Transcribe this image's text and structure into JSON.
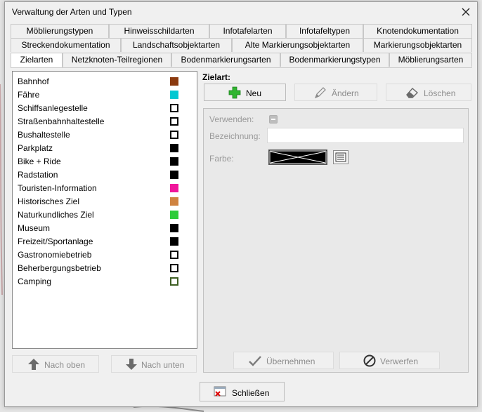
{
  "window": {
    "title": "Verwaltung der Arten und Typen"
  },
  "tabs": {
    "row1": [
      "Möblierungstypen",
      "Hinweisschildarten",
      "Infotafelarten",
      "Infotafeltypen",
      "Knotendokumentation"
    ],
    "row2": [
      "Streckendokumentation",
      "Landschaftsobjektarten",
      "Alte Markierungsobjektarten",
      "Markierungsobjektarten"
    ],
    "row3": [
      "Zielarten",
      "Netzknoten-Teilregionen",
      "Bodenmarkierungsarten",
      "Bodenmarkierungstypen",
      "Möblierungsarten"
    ],
    "selected": "Zielarten"
  },
  "zielarten": [
    {
      "label": "Bahnhof",
      "color": "#8b3a0f",
      "style": "filled"
    },
    {
      "label": "Fähre",
      "color": "#00c8d2",
      "style": "filled"
    },
    {
      "label": "Schiffsanlegestelle",
      "color": "#000000",
      "style": "outline"
    },
    {
      "label": "Straßenbahnhaltestelle",
      "color": "#000000",
      "style": "outline"
    },
    {
      "label": "Bushaltestelle",
      "color": "#000000",
      "style": "outline"
    },
    {
      "label": "Parkplatz",
      "color": "#000000",
      "style": "filled"
    },
    {
      "label": "Bike + Ride",
      "color": "#000000",
      "style": "filled"
    },
    {
      "label": "Radstation",
      "color": "#000000",
      "style": "filled"
    },
    {
      "label": "Touristen-Information",
      "color": "#f0169b",
      "style": "filled"
    },
    {
      "label": "Historisches Ziel",
      "color": "#cf8340",
      "style": "filled"
    },
    {
      "label": "Naturkundliches Ziel",
      "color": "#2ecc3a",
      "style": "filled"
    },
    {
      "label": "Museum",
      "color": "#000000",
      "style": "filled"
    },
    {
      "label": "Freizeit/Sportanlage",
      "color": "#000000",
      "style": "filled"
    },
    {
      "label": "Gastronomiebetrieb",
      "color": "#000000",
      "style": "outline"
    },
    {
      "label": "Beherbergungsbetrieb",
      "color": "#000000",
      "style": "outline"
    },
    {
      "label": "Camping",
      "color": "#3f5f24",
      "style": "outline"
    }
  ],
  "detail": {
    "heading": "Zielart:",
    "new_label": "Neu",
    "edit_label": "Ändern",
    "delete_label": "Löschen",
    "use_label": "Verwenden:",
    "name_label": "Bezeichnung:",
    "name_value": "",
    "color_label": "Farbe:",
    "apply_label": "Übernehmen",
    "discard_label": "Verwerfen"
  },
  "list_buttons": {
    "up_label": "Nach oben",
    "down_label": "Nach unten"
  },
  "footer": {
    "close_label": "Schließen"
  },
  "icons": {
    "close": "close-icon",
    "new": "green-plus-icon",
    "edit": "pencil-icon",
    "delete": "eraser-icon",
    "up": "arrow-up-icon",
    "down": "arrow-down-icon",
    "apply": "checkmark-icon",
    "discard": "forbidden-icon",
    "color_picker": "palette-list-icon",
    "exit": "exit-window-icon"
  }
}
